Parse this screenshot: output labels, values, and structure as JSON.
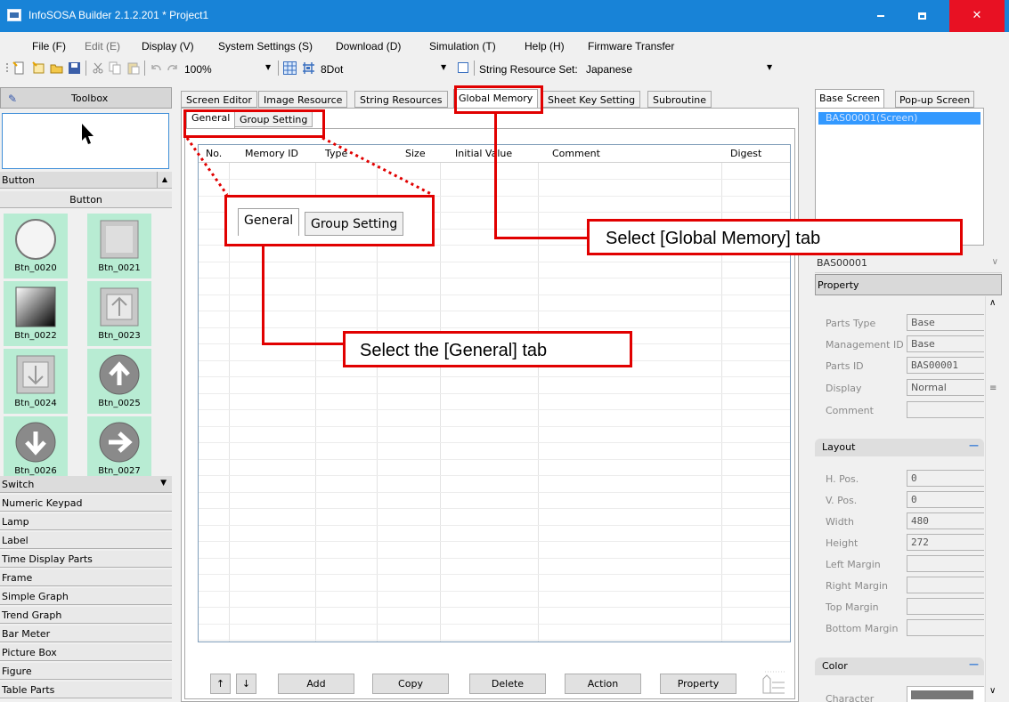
{
  "window": {
    "title": "InfoSOSA Builder 2.1.2.201 * Project1"
  },
  "menu": [
    {
      "label": "File (F)",
      "enabled": true
    },
    {
      "label": "Edit (E)",
      "enabled": false
    },
    {
      "label": "Display (V)",
      "enabled": true
    },
    {
      "label": "System Settings (S)",
      "enabled": true
    },
    {
      "label": "Download (D)",
      "enabled": true
    },
    {
      "label": "Simulation (T)",
      "enabled": true
    },
    {
      "label": "Help (H)",
      "enabled": true
    },
    {
      "label": "Firmware Transfer",
      "enabled": true
    }
  ],
  "toolbar": {
    "zoom": "100%",
    "grid": "8Dot",
    "string_resource_label": "String Resource Set:",
    "string_resource_value": "Japanese"
  },
  "toolbox": {
    "header": "Toolbox",
    "category_open": "Button",
    "subcategory": "Button",
    "buttons": [
      "Btn_0020",
      "Btn_0021",
      "Btn_0022",
      "Btn_0023",
      "Btn_0024",
      "Btn_0025",
      "Btn_0026",
      "Btn_0027"
    ],
    "categories": [
      "Switch",
      "Numeric Keypad",
      "Lamp",
      "Label",
      "Time Display Parts",
      "Frame",
      "Simple Graph",
      "Trend Graph",
      "Bar Meter",
      "Picture Box",
      "Figure",
      "Table Parts"
    ]
  },
  "main_tabs": [
    "Screen Editor",
    "Image Resource",
    "String Resources",
    "Global Memory",
    "Sheet Key Setting",
    "Subroutine"
  ],
  "sub_tabs": [
    "General",
    "Group Setting"
  ],
  "grid_columns": [
    "No.",
    "Memory ID",
    "Type",
    "Size",
    "Initial Value",
    "Comment",
    "Digest"
  ],
  "bottom_buttons": {
    "up": "↑",
    "down": "↓",
    "add": "Add",
    "copy": "Copy",
    "delete": "Delete",
    "action": "Action",
    "property": "Property"
  },
  "right_tabs": [
    "Base Screen",
    "Pop-up Screen"
  ],
  "screen_item": "BAS00001(Screen)",
  "object_select": "BAS00001",
  "property": {
    "header": "Property",
    "rows": [
      {
        "label": "Parts Type",
        "value": "Base"
      },
      {
        "label": "Management ID",
        "value": "Base"
      },
      {
        "label": "Parts ID",
        "value": "BAS00001"
      },
      {
        "label": "Display",
        "value": "Normal"
      },
      {
        "label": "Comment",
        "value": ""
      }
    ],
    "layout_header": "Layout",
    "layout": [
      {
        "label": "H. Pos.",
        "value": "0"
      },
      {
        "label": "V. Pos.",
        "value": "0"
      },
      {
        "label": "Width",
        "value": "480"
      },
      {
        "label": "Height",
        "value": "272"
      },
      {
        "label": "Left Margin",
        "value": ""
      },
      {
        "label": "Right Margin",
        "value": ""
      },
      {
        "label": "Top Margin",
        "value": ""
      },
      {
        "label": "Bottom Margin",
        "value": ""
      }
    ],
    "color_header": "Color",
    "color_row": "Character"
  },
  "annotations": {
    "global_memory": "Select [Global Memory] tab",
    "general": "Select the [General] tab",
    "zoom_tabs": [
      "General",
      "Group Setting"
    ]
  },
  "colors": {
    "title_bar": "#1883d7",
    "annotation": "#e10000",
    "selection": "#3399ff",
    "button_cell_bg": "#b8ecd3"
  }
}
